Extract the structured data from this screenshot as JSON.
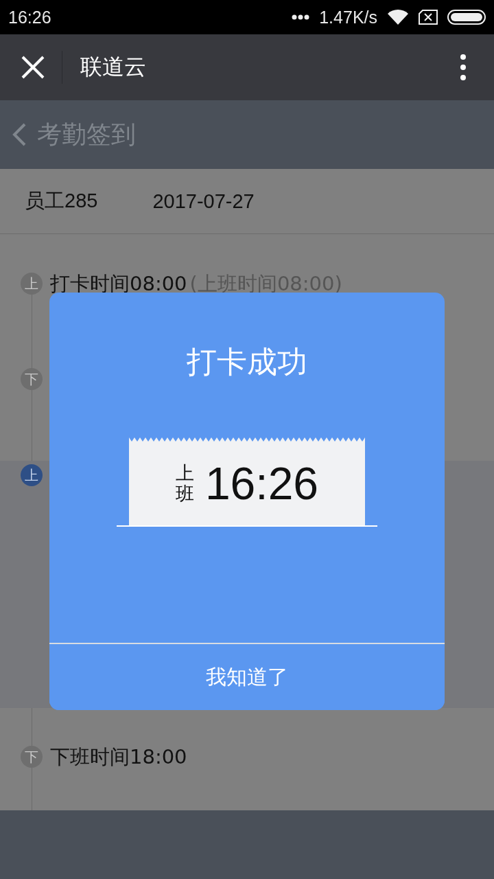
{
  "status_bar": {
    "time": "16:26",
    "speed": "1.47K/s"
  },
  "title_bar": {
    "title": "联道云"
  },
  "page_header": {
    "title": "考勤签到"
  },
  "info": {
    "employee": "员工285",
    "date": "2017-07-27"
  },
  "timeline": [
    {
      "badge": "上",
      "time": "打卡时间08:00",
      "note": "(上班时间08:00)",
      "current": false
    },
    {
      "badge": "下",
      "current": false
    },
    {
      "badge": "上",
      "current": true
    },
    {
      "badge": "下",
      "time": "下班时间18:00",
      "current": false
    }
  ],
  "dialog": {
    "title": "打卡成功",
    "shift": "上班",
    "time": "16:26",
    "button": "我知道了"
  }
}
